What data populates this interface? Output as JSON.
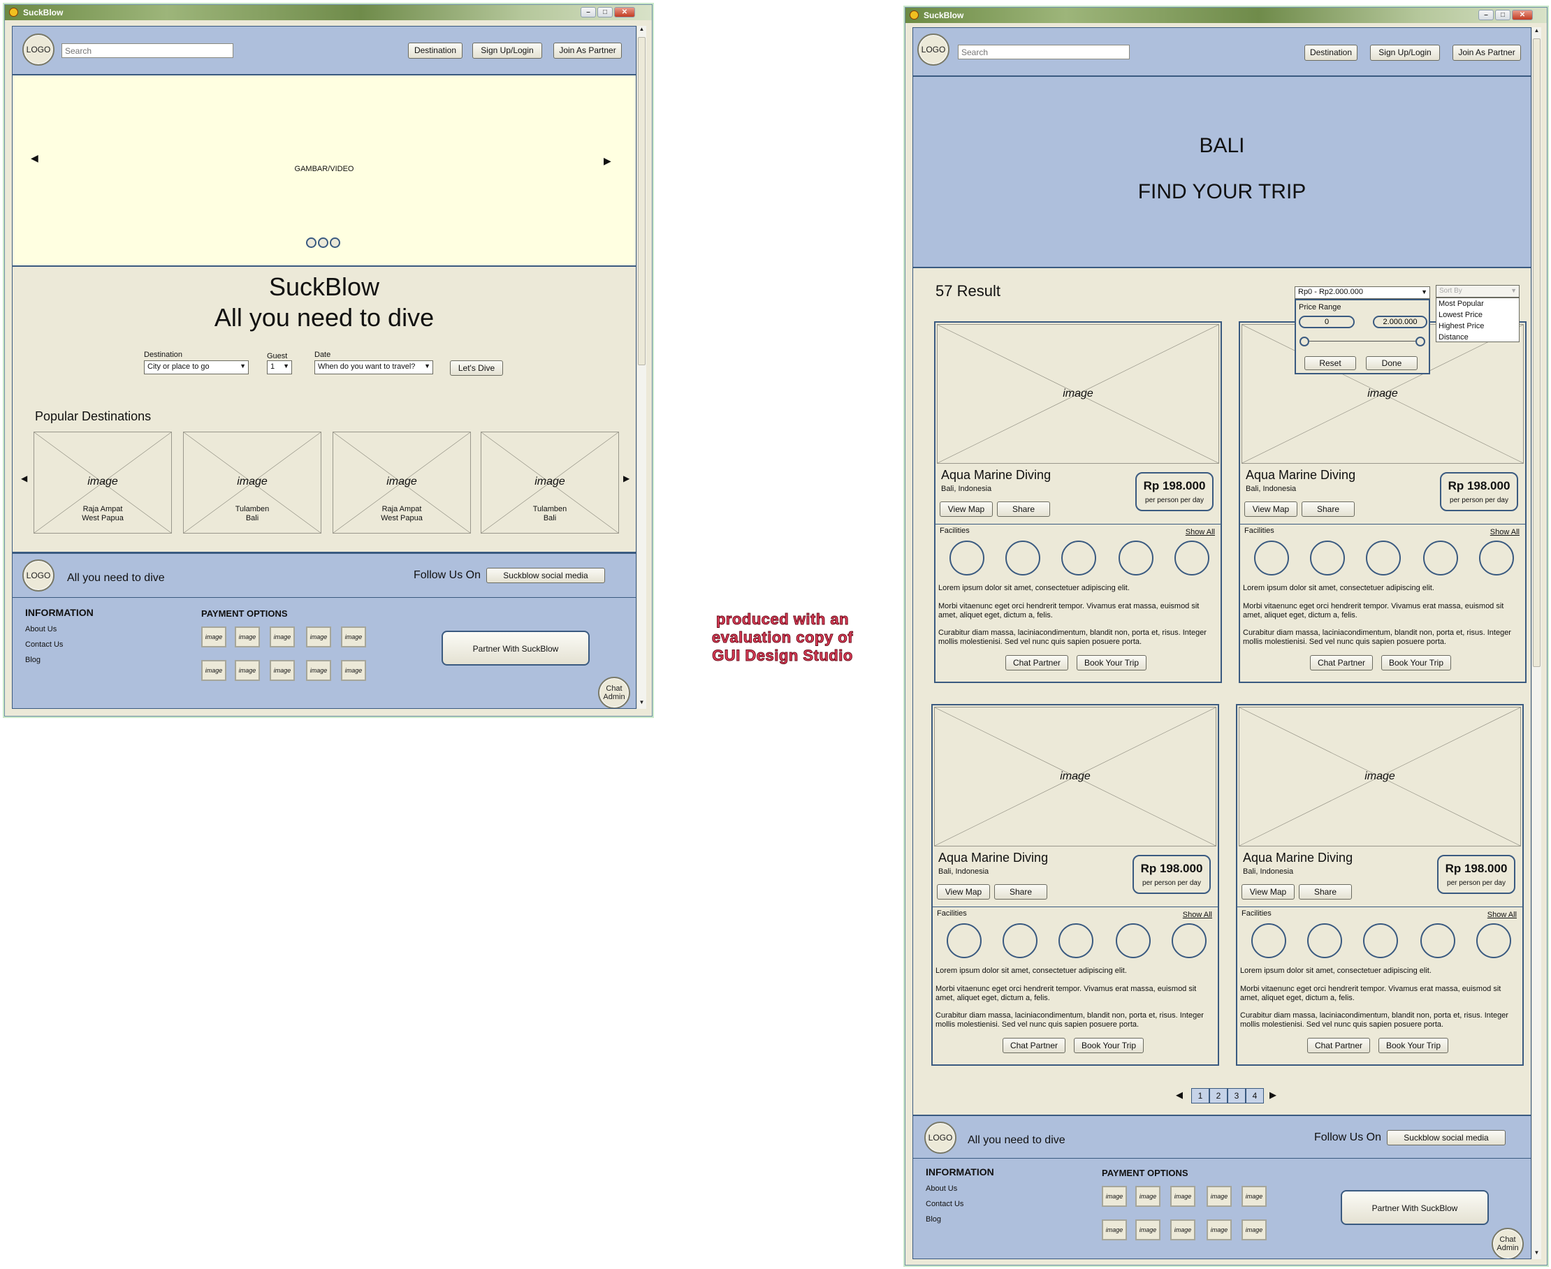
{
  "app_title": "SuckBlow",
  "window_buttons": {
    "minimize": "–",
    "maximize": "□",
    "close": "✕"
  },
  "header": {
    "logo": "LOGO",
    "search_placeholder": "Search",
    "nav": [
      "Destination",
      "Sign Up/Login",
      "Join As Partner"
    ]
  },
  "home": {
    "hero_label": "GAMBAR/VIDEO",
    "title": "SuckBlow",
    "tagline": "All you need to dive",
    "form": {
      "destination_label": "Destination",
      "destination_value": "City or place to go",
      "guest_label": "Guest",
      "guest_value": "1",
      "date_label": "Date",
      "date_value": "When do you want to travel?",
      "submit": "Let's Dive"
    },
    "popular_title": "Popular Destinations",
    "destinations": [
      {
        "image": "image",
        "line1": "Raja Ampat",
        "line2": "West Papua"
      },
      {
        "image": "image",
        "line1": "Tulamben",
        "line2": "Bali"
      },
      {
        "image": "image",
        "line1": "Raja Ampat",
        "line2": "West Papua"
      },
      {
        "image": "image",
        "line1": "Tulamben",
        "line2": "Bali"
      }
    ]
  },
  "footer": {
    "logo": "LOGO",
    "tagline": "All you need to dive",
    "follow_label": "Follow Us On",
    "social_button": "Suckblow social media",
    "information_title": "INFORMATION",
    "info_links": [
      "About Us",
      "Contact Us",
      "Blog"
    ],
    "payment_title": "PAYMENT OPTIONS",
    "payment_image": "image",
    "partner_button": "Partner With SuckBlow",
    "chat_line1": "Chat",
    "chat_line2": "Admin"
  },
  "results": {
    "hero_line1": "BALI",
    "hero_line2": "FIND YOUR TRIP",
    "count_text": "57 Result",
    "price_filter_value": "Rp0 - Rp2.000.000",
    "price_range_label": "Price Range",
    "price_min": "0",
    "price_max": "2.000.000",
    "price_min_fraction": 0,
    "price_max_fraction": 1,
    "reset": "Reset",
    "done": "Done",
    "sort_placeholder": "Sort By",
    "sort_options": [
      "Most Popular",
      "Lowest Price",
      "Highest Price",
      "Distance"
    ],
    "card": {
      "image": "image",
      "title": "Aqua Marine Diving",
      "location": "Bali, Indonesia",
      "price": "Rp 198.000",
      "price_unit": "per person per day",
      "view_map": "View Map",
      "share": "Share",
      "facilities": "Facilities",
      "show_all": "Show All",
      "p1": "Lorem ipsum dolor sit amet, consectetuer adipiscing elit.",
      "p2": "Morbi vitaenunc eget orci hendrerit tempor. Vivamus erat massa, euismod sit amet, aliquet eget, dictum a, felis.",
      "p3": "Curabitur diam massa, laciniacondimentum, blandit non, porta et, risus. Integer mollis molestienisi. Sed vel nunc quis sapien posuere porta.",
      "chat_partner": "Chat Partner",
      "book": "Book Your Trip"
    },
    "pages": [
      "1",
      "2",
      "3",
      "4"
    ]
  },
  "watermark": [
    "produced with an",
    "evaluation copy of",
    "GUI Design Studio"
  ]
}
